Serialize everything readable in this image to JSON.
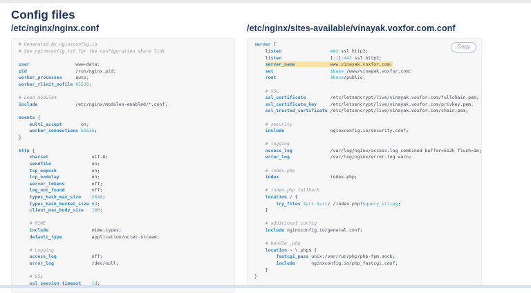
{
  "header": {
    "title": "Config files"
  },
  "colors": {
    "heading": "#1e3560",
    "keyword": "#2f7fc1",
    "number": "#35aed4",
    "comment": "#8f969e",
    "plain": "#404650",
    "highlight": "#fce3a1",
    "panel_bg": "#f7f7f8"
  },
  "panels": [
    {
      "id": "nginx-conf",
      "title": "/etc/nginx/nginx.conf",
      "lines": [
        [
          [
            "c",
            "# Generated by nginxconfig.io"
          ]
        ],
        [
          [
            "c",
            "# See nginxconfig.txt for the configuration share link"
          ]
        ],
        [],
        [
          [
            "k",
            "user"
          ],
          [
            "p",
            "                 www-data;"
          ]
        ],
        [
          [
            "k",
            "pid"
          ],
          [
            "p",
            "                  /run/nginx.pid;"
          ]
        ],
        [
          [
            "k",
            "worker_processes"
          ],
          [
            "p",
            "     auto;"
          ]
        ],
        [
          [
            "k",
            "worker_rlimit_nofile"
          ],
          [
            "p",
            " "
          ],
          [
            "n",
            "65535"
          ],
          [
            "p",
            ";"
          ]
        ],
        [],
        [
          [
            "c",
            "# Load modules"
          ]
        ],
        [
          [
            "k",
            "include"
          ],
          [
            "p",
            "              /etc/nginx/modules-enabled/*.conf;"
          ]
        ],
        [],
        [
          [
            "k",
            "events"
          ],
          [
            "p",
            " {"
          ]
        ],
        [
          [
            "p",
            "    "
          ],
          [
            "k",
            "multi_accept"
          ],
          [
            "p",
            "       on;"
          ]
        ],
        [
          [
            "p",
            "    "
          ],
          [
            "k",
            "worker_connections"
          ],
          [
            "p",
            " "
          ],
          [
            "n",
            "65535"
          ],
          [
            "p",
            ";"
          ]
        ],
        [
          [
            "p",
            "}"
          ]
        ],
        [],
        [
          [
            "k",
            "http"
          ],
          [
            "p",
            " {"
          ]
        ],
        [
          [
            "p",
            "    "
          ],
          [
            "k",
            "charset"
          ],
          [
            "p",
            "                utf-8;"
          ]
        ],
        [
          [
            "p",
            "    "
          ],
          [
            "k",
            "sendfile"
          ],
          [
            "p",
            "               on;"
          ]
        ],
        [
          [
            "p",
            "    "
          ],
          [
            "k",
            "tcp_nopush"
          ],
          [
            "p",
            "             on;"
          ]
        ],
        [
          [
            "p",
            "    "
          ],
          [
            "k",
            "tcp_nodelay"
          ],
          [
            "p",
            "            on;"
          ]
        ],
        [
          [
            "p",
            "    "
          ],
          [
            "k",
            "server_tokens"
          ],
          [
            "p",
            "          off;"
          ]
        ],
        [
          [
            "p",
            "    "
          ],
          [
            "k",
            "log_not_found"
          ],
          [
            "p",
            "          off;"
          ]
        ],
        [
          [
            "p",
            "    "
          ],
          [
            "k",
            "types_hash_max_size"
          ],
          [
            "p",
            "    "
          ],
          [
            "n",
            "2048"
          ],
          [
            "p",
            ";"
          ]
        ],
        [
          [
            "p",
            "    "
          ],
          [
            "k",
            "types_hash_bucket_size"
          ],
          [
            "p",
            " "
          ],
          [
            "n",
            "64"
          ],
          [
            "p",
            ";"
          ]
        ],
        [
          [
            "p",
            "    "
          ],
          [
            "k",
            "client_max_body_size"
          ],
          [
            "p",
            "   "
          ],
          [
            "n",
            "16M"
          ],
          [
            "p",
            ";"
          ]
        ],
        [],
        [
          [
            "p",
            "    "
          ],
          [
            "c",
            "# MIME"
          ]
        ],
        [
          [
            "p",
            "    "
          ],
          [
            "k",
            "include"
          ],
          [
            "p",
            "                mime.types;"
          ]
        ],
        [
          [
            "p",
            "    "
          ],
          [
            "k",
            "default_type"
          ],
          [
            "p",
            "           application/octet-stream;"
          ]
        ],
        [],
        [
          [
            "p",
            "    "
          ],
          [
            "c",
            "# Logging"
          ]
        ],
        [
          [
            "p",
            "    "
          ],
          [
            "k",
            "access_log"
          ],
          [
            "p",
            "             off;"
          ]
        ],
        [
          [
            "p",
            "    "
          ],
          [
            "k",
            "error_log"
          ],
          [
            "p",
            "              /dev/null;"
          ]
        ],
        [],
        [
          [
            "p",
            "    "
          ],
          [
            "c",
            "# SSL"
          ]
        ],
        [
          [
            "p",
            "    "
          ],
          [
            "k",
            "ssl_session_timeout"
          ],
          [
            "p",
            "    "
          ],
          [
            "n",
            "1d"
          ],
          [
            "p",
            ";"
          ]
        ]
      ]
    },
    {
      "id": "site-conf",
      "title": "/etc/nginx/sites-available/vinayak.voxfor.com.conf",
      "copy_label": "Copy",
      "lines": [
        [
          [
            "k",
            "server"
          ],
          [
            "p",
            " {"
          ]
        ],
        [
          [
            "p",
            "    "
          ],
          [
            "k",
            "listen"
          ],
          [
            "p",
            "                  "
          ],
          [
            "n",
            "443"
          ],
          [
            "p",
            " ssl http2;"
          ]
        ],
        [
          [
            "p",
            "    "
          ],
          [
            "k",
            "listen"
          ],
          [
            "p",
            "                  [::]:"
          ],
          [
            "n",
            "443"
          ],
          [
            "p",
            " ssl http2;"
          ]
        ],
        [
          [
            "p",
            "    "
          ],
          [
            "kh",
            "server_name"
          ],
          [
            "ph",
            "             www.vinayak.voxfor.com;"
          ]
        ],
        [
          [
            "p",
            "    "
          ],
          [
            "k",
            "set"
          ],
          [
            "p",
            "                     "
          ],
          [
            "n",
            "$base"
          ],
          [
            "p",
            " /www/vinayak.voxfor.com;"
          ]
        ],
        [
          [
            "p",
            "    "
          ],
          [
            "k",
            "root"
          ],
          [
            "p",
            "                    "
          ],
          [
            "n",
            "$base"
          ],
          [
            "p",
            "/public;"
          ]
        ],
        [],
        [
          [
            "p",
            "    "
          ],
          [
            "c",
            "# SSL"
          ]
        ],
        [
          [
            "p",
            "    "
          ],
          [
            "k",
            "ssl_certificate"
          ],
          [
            "p",
            "         /etc/letsencrypt/live/vinayak.voxfor.com/fullchain.pem;"
          ]
        ],
        [
          [
            "p",
            "    "
          ],
          [
            "k",
            "ssl_certificate_key"
          ],
          [
            "p",
            "     /etc/letsencrypt/live/vinayak.voxfor.com/privkey.pem;"
          ]
        ],
        [
          [
            "p",
            "    "
          ],
          [
            "k",
            "ssl_trusted_certificate"
          ],
          [
            "p",
            " /etc/letsencrypt/live/vinayak.voxfor.com/chain.pem;"
          ]
        ],
        [],
        [
          [
            "p",
            "    "
          ],
          [
            "c",
            "# security"
          ]
        ],
        [
          [
            "p",
            "    "
          ],
          [
            "k",
            "include"
          ],
          [
            "p",
            "                 nginxconfig.io/security.conf;"
          ]
        ],
        [],
        [
          [
            "p",
            "    "
          ],
          [
            "c",
            "# logging"
          ]
        ],
        [
          [
            "p",
            "    "
          ],
          [
            "k",
            "access_log"
          ],
          [
            "p",
            "              /var/log/nginx/access.log combined buffer=512k flush=1m;"
          ]
        ],
        [
          [
            "p",
            "    "
          ],
          [
            "k",
            "error_log"
          ],
          [
            "p",
            "               /var/log/nginx/error.log warn;"
          ]
        ],
        [],
        [
          [
            "p",
            "    "
          ],
          [
            "c",
            "# index.php"
          ]
        ],
        [
          [
            "p",
            "    "
          ],
          [
            "k",
            "index"
          ],
          [
            "p",
            "                   index.php;"
          ]
        ],
        [],
        [
          [
            "p",
            "    "
          ],
          [
            "c",
            "# index.php fallback"
          ]
        ],
        [
          [
            "p",
            "    "
          ],
          [
            "k",
            "location"
          ],
          [
            "p",
            " / {"
          ]
        ],
        [
          [
            "p",
            "        "
          ],
          [
            "k",
            "try_files"
          ],
          [
            "p",
            " "
          ],
          [
            "n",
            "$uri"
          ],
          [
            "p",
            " "
          ],
          [
            "n",
            "$uri"
          ],
          [
            "p",
            "/ /index.php?"
          ],
          [
            "n",
            "$query_string"
          ],
          [
            "p",
            ";"
          ]
        ],
        [
          [
            "p",
            "    }"
          ]
        ],
        [],
        [
          [
            "p",
            "    "
          ],
          [
            "c",
            "# additional config"
          ]
        ],
        [
          [
            "p",
            "    "
          ],
          [
            "k",
            "include"
          ],
          [
            "p",
            " nginxconfig.io/general.conf;"
          ]
        ],
        [],
        [
          [
            "p",
            "    "
          ],
          [
            "c",
            "# handle .php"
          ]
        ],
        [
          [
            "p",
            "    "
          ],
          [
            "k",
            "location"
          ],
          [
            "p",
            " ~ \\.php$ {"
          ]
        ],
        [
          [
            "p",
            "        "
          ],
          [
            "k",
            "fastcgi_pass"
          ],
          [
            "p",
            " unix:/var/run/php/php-fpm.sock;"
          ]
        ],
        [
          [
            "p",
            "        "
          ],
          [
            "k",
            "include"
          ],
          [
            "p",
            "      nginxconfig.io/php_fastcgi.conf;"
          ]
        ],
        [
          [
            "p",
            "    }"
          ]
        ],
        [
          [
            "p",
            "}"
          ]
        ]
      ]
    }
  ]
}
